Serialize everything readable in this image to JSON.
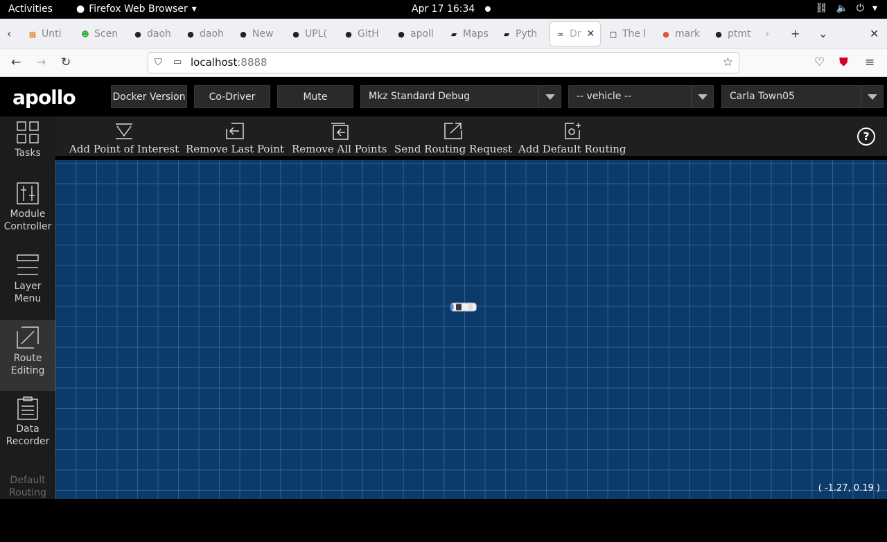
{
  "os_bar": {
    "activities": "Activities",
    "app_name": "Firefox Web Browser",
    "clock": "Apr 17  16:34"
  },
  "browser": {
    "tabs": [
      {
        "label": "Unti",
        "icon": "orange-grid-icon"
      },
      {
        "label": "Scen",
        "icon": "smiley-icon"
      },
      {
        "label": "daoh",
        "icon": "github-icon"
      },
      {
        "label": "daoh",
        "icon": "github-icon"
      },
      {
        "label": "New",
        "icon": "github-icon"
      },
      {
        "label": "UPL(",
        "icon": "github-icon"
      },
      {
        "label": "GitH",
        "icon": "github-icon"
      },
      {
        "label": "apoll",
        "icon": "github-icon"
      },
      {
        "label": "Maps",
        "icon": "book-icon"
      },
      {
        "label": "Pyth",
        "icon": "book-icon"
      },
      {
        "label": "Dr",
        "icon": "apollo-icon",
        "active": true
      },
      {
        "label": "The l",
        "icon": "square-icon"
      },
      {
        "label": "mark",
        "icon": "duckduckgo-icon"
      },
      {
        "label": "ptmt",
        "icon": "github-icon"
      }
    ],
    "url_host": "localhost",
    "url_port": ":8888"
  },
  "header": {
    "logo": "apollo",
    "buttons": [
      "Docker Version",
      "Co-Driver",
      "Mute"
    ],
    "mode_select": "Mkz Standard Debug",
    "vehicle_select": "-- vehicle --",
    "map_select": "Carla Town05"
  },
  "sidebar": {
    "items": [
      {
        "label": "Tasks",
        "icon": "grid-icon"
      },
      {
        "label": "Module Controller",
        "icon": "sliders-icon"
      },
      {
        "label": "Layer Menu",
        "icon": "layers-icon"
      },
      {
        "label": "Route Editing",
        "icon": "route-icon",
        "active": true
      },
      {
        "label": "Data Recorder",
        "icon": "clipboard-icon"
      },
      {
        "label": "Default Routing",
        "icon": "none",
        "disabled": true
      }
    ]
  },
  "toolbar": {
    "add_poi": "Add Point of Interest",
    "remove_last": "Remove Last Point",
    "remove_all": "Remove All Points",
    "send_routing": "Send Routing Request",
    "add_default": "Add Default Routing",
    "help": "?"
  },
  "map": {
    "coordinates": "( -1.27, 0.19 )",
    "background_color": "#0d3b69"
  }
}
